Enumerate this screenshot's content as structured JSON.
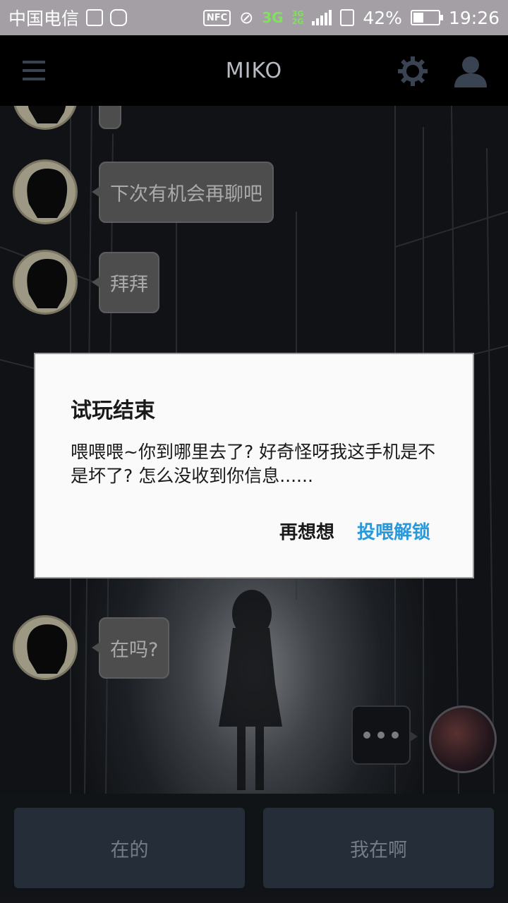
{
  "status_bar": {
    "carrier": "中国电信",
    "nfc": "NFC",
    "network": "3G",
    "network_alt": [
      "3G",
      "2G"
    ],
    "battery": "42%",
    "battery_level": 0.42,
    "time": "19:26"
  },
  "app_bar": {
    "title": "MIKO"
  },
  "chat": {
    "messages": [
      {
        "text": "下次有机会再聊吧"
      },
      {
        "text": "拜拜"
      },
      {
        "text": "在吗?"
      }
    ]
  },
  "dialog": {
    "title": "试玩结束",
    "message": "喂喂喂~你到哪里去了? 好奇怪呀我这手机是不是坏了? 怎么没收到你信息......",
    "reconsider_label": "再想想",
    "unlock_label": "投喂解锁"
  },
  "replies": {
    "options": [
      "在的",
      "我在啊"
    ]
  },
  "colors": {
    "accent": "#2b98d9",
    "reply_button": "#2c3644"
  }
}
